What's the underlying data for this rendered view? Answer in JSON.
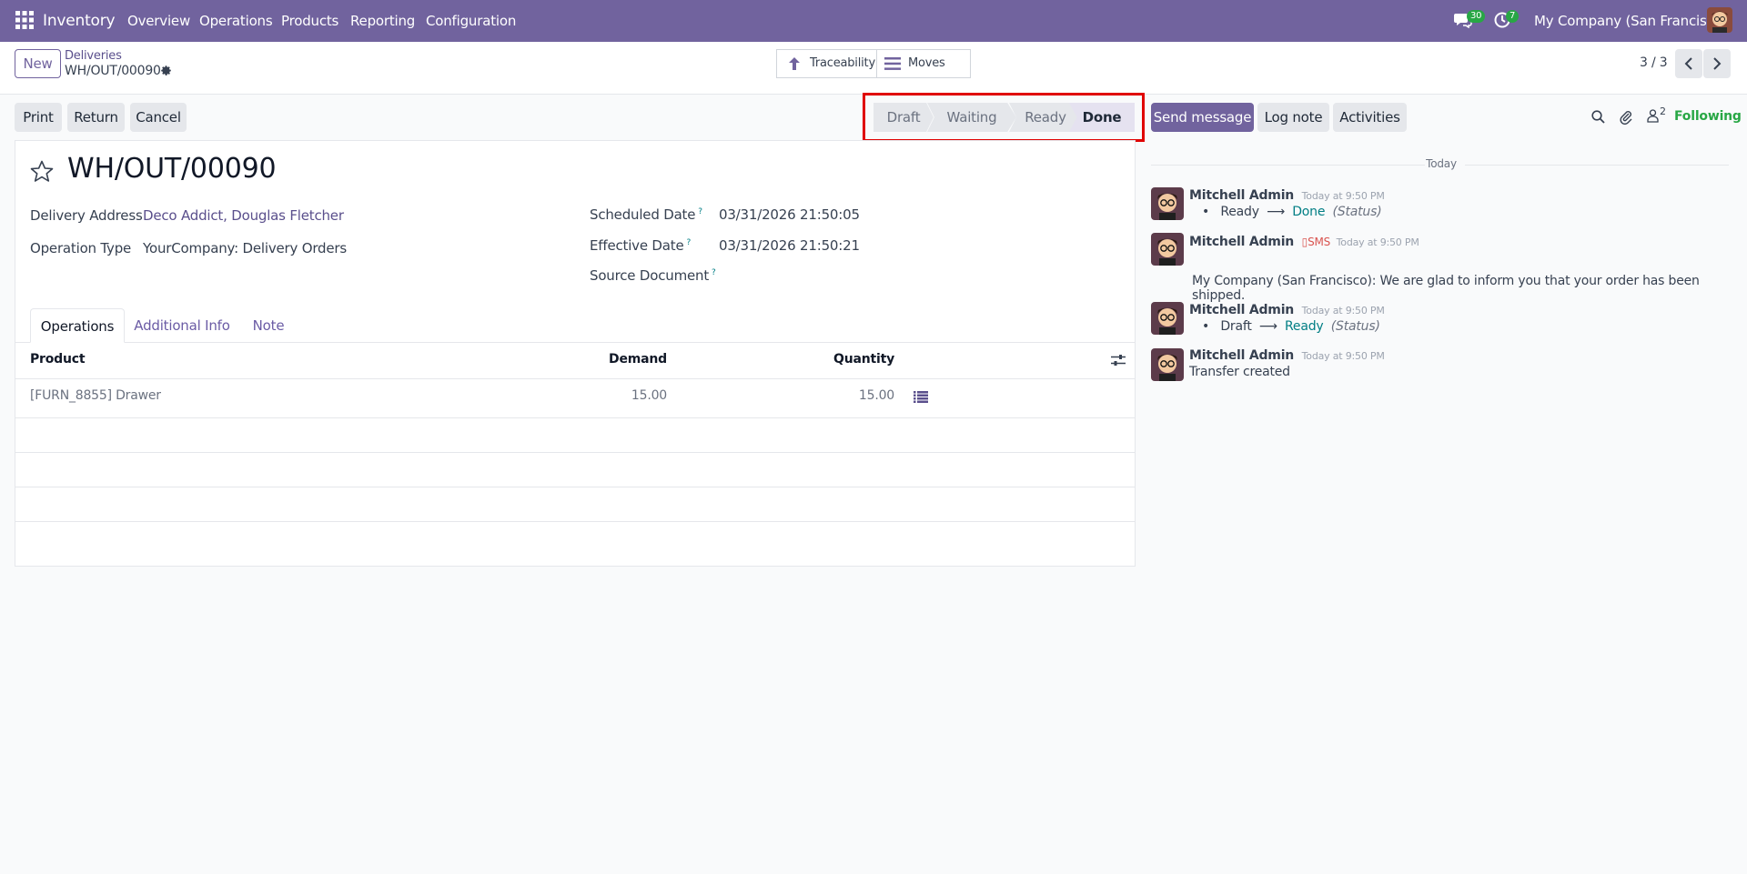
{
  "navbar": {
    "app_name": "Inventory",
    "menu": [
      "Overview",
      "Operations",
      "Products",
      "Reporting",
      "Configuration"
    ],
    "messages_badge": "30",
    "activities_badge": "7",
    "company": "My Company (San Francisco)"
  },
  "control_panel": {
    "new_label": "New",
    "breadcrumb_parent": "Deliveries",
    "breadcrumb_current": "WH/OUT/00090",
    "traceability_label": "Traceability",
    "moves_label": "Moves",
    "pager": "3 / 3"
  },
  "actions": {
    "print": "Print",
    "return": "Return",
    "cancel": "Cancel"
  },
  "statusbar": {
    "stages": [
      "Draft",
      "Waiting",
      "Ready",
      "Done"
    ],
    "active": "Done"
  },
  "form": {
    "title": "WH/OUT/00090",
    "delivery_address_label": "Delivery Address",
    "delivery_address": "Deco Addict, Douglas Fletcher",
    "operation_type_label": "Operation Type",
    "operation_type": "YourCompany: Delivery Orders",
    "scheduled_date_label": "Scheduled Date",
    "scheduled_date": "03/31/2026 21:50:05",
    "effective_date_label": "Effective Date",
    "effective_date": "03/31/2026 21:50:21",
    "source_document_label": "Source Document",
    "help_mark": "?",
    "tabs": [
      "Operations",
      "Additional Info",
      "Note"
    ],
    "table": {
      "headers": {
        "product": "Product",
        "demand": "Demand",
        "quantity": "Quantity"
      },
      "rows": [
        {
          "product": "[FURN_8855] Drawer",
          "demand": "15.00",
          "quantity": "15.00"
        }
      ]
    }
  },
  "chatter": {
    "send_message": "Send message",
    "log_note": "Log note",
    "activities": "Activities",
    "followers_count": "2",
    "following": "Following",
    "date_separator": "Today",
    "messages": [
      {
        "author": "Mitchell Admin",
        "time": "Today at 9:50 PM",
        "from": "Ready",
        "to": "Done",
        "field": "(Status)"
      },
      {
        "author": "Mitchell Admin",
        "tag": "SMS",
        "time": "Today at 9:50 PM",
        "body": "My Company (San Francisco): We are glad to inform you that your order has been shipped."
      },
      {
        "author": "Mitchell Admin",
        "time": "Today at 9:50 PM",
        "from": "Draft",
        "to": "Ready",
        "field": "(Status)"
      },
      {
        "author": "Mitchell Admin",
        "time": "Today at 9:50 PM",
        "body": "Transfer created"
      }
    ]
  },
  "colors": {
    "brand": "#71639e",
    "highlight_box": "#e00000",
    "link_teal": "#017e84",
    "following_green": "#28a745"
  }
}
